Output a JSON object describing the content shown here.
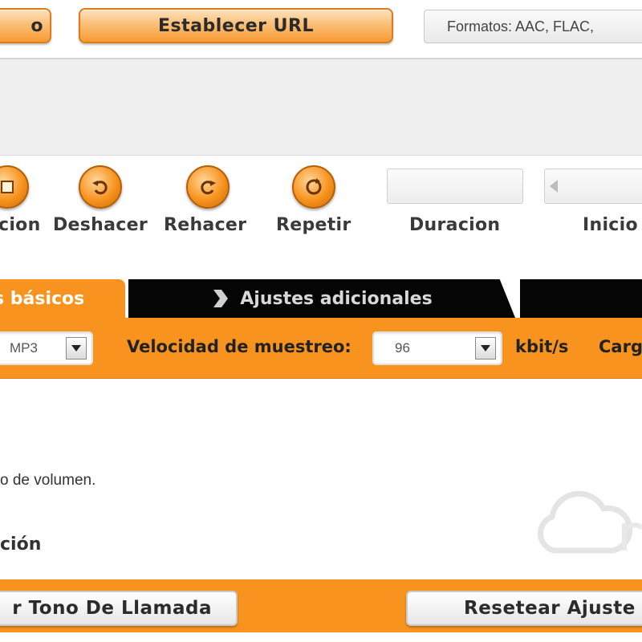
{
  "topbar": {
    "prev_button_label": "o",
    "set_url_label": "Establecer URL",
    "formats_label": "Formatos: AAC, FLAC, "
  },
  "controls": [
    {
      "label": "cion",
      "icon": "partial-icon"
    },
    {
      "label": "Deshacer",
      "icon": "undo-icon"
    },
    {
      "label": "Rehacer",
      "icon": "redo-icon"
    },
    {
      "label": "Repetir",
      "icon": "repeat-icon"
    }
  ],
  "fields": {
    "duration_label": "Duracion",
    "start_label": "Inicio"
  },
  "tabs": {
    "basic": "s básicos",
    "additional": "Ajustes adicionales"
  },
  "settings": {
    "format_value": "MP3",
    "bitrate_label": "Velocidad de muestreo:",
    "bitrate_value": "96",
    "bitrate_unit": "kbit/s",
    "load_label": "Carg"
  },
  "content": {
    "volume_text": "o de volumen.",
    "cion_text": "ción"
  },
  "bottom": {
    "ringtone_button": "r Tono De Llamada",
    "reset_button": "Resetear Ajuste"
  },
  "colors": {
    "accent": "#f7931e",
    "tab_dark": "#050505"
  }
}
